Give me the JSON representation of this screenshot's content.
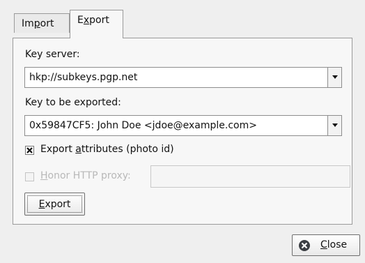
{
  "tabs": [
    {
      "label_pre": "Im",
      "label_u": "p",
      "label_post": "ort",
      "active": false
    },
    {
      "label_pre": "E",
      "label_u": "x",
      "label_post": "port",
      "active": true
    }
  ],
  "key_server": {
    "label": "Key server:",
    "value": "hkp://subkeys.pgp.net"
  },
  "key_export": {
    "label": "Key to be exported:",
    "value": "0x59847CF5: John Doe <jdoe@example.com>"
  },
  "export_attributes": {
    "label_pre": "Export ",
    "label_u": "a",
    "label_post": "ttributes (photo id)",
    "checked": true
  },
  "honor_proxy": {
    "label_pre": "",
    "label_u": "H",
    "label_post": "onor HTTP proxy:",
    "checked": false,
    "disabled": true,
    "input_value": ""
  },
  "export_button": {
    "label_pre": "",
    "label_u": "E",
    "label_post": "xport"
  },
  "close_button": {
    "label_pre": "",
    "label_u": "C",
    "label_post": "lose"
  },
  "icons": {
    "dropdown": "chevron-down-icon",
    "checkmark": "x-check-icon",
    "close": "close-circle-icon"
  }
}
